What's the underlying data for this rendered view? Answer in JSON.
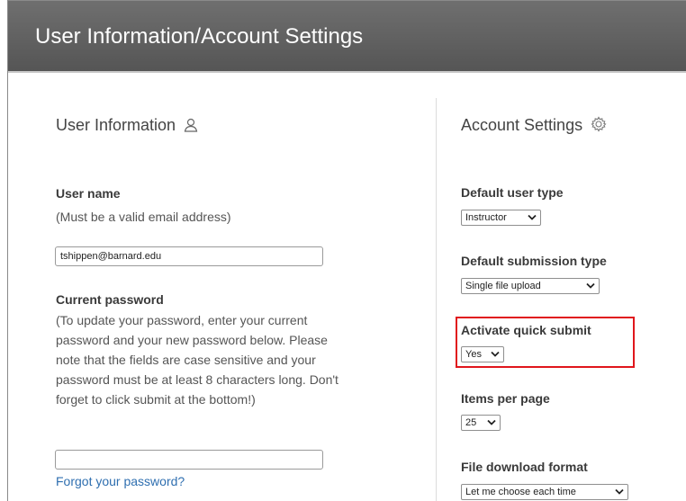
{
  "header": {
    "title": "User Information/Account Settings"
  },
  "user_info": {
    "title": "User Information",
    "icon": "user-icon",
    "username_label": "User name",
    "username_hint": "(Must be a valid email address)",
    "username_value": "tshippen@barnard.edu",
    "password_label": "Current password",
    "password_hint_lines": [
      "(To update your password, enter your current",
      "password and your new password below. Please",
      "note that the fields are case sensitive and your",
      "password must be at least 8 characters long. Don't",
      "forget to click submit at the bottom!)"
    ],
    "password_value": "",
    "forgot_link": "Forgot your password?"
  },
  "account_settings": {
    "title": "Account Settings",
    "icon": "gear-icon",
    "default_user_type": {
      "label": "Default user type",
      "value": "Instructor"
    },
    "default_submission_type": {
      "label": "Default submission type",
      "value": "Single file upload"
    },
    "quick_submit": {
      "label": "Activate quick submit",
      "value": "Yes",
      "highlight_color": "#e0161c"
    },
    "items_per_page": {
      "label": "Items per page",
      "value": "25"
    },
    "file_download_format": {
      "label": "File download format",
      "value": "Let me choose each time"
    }
  }
}
